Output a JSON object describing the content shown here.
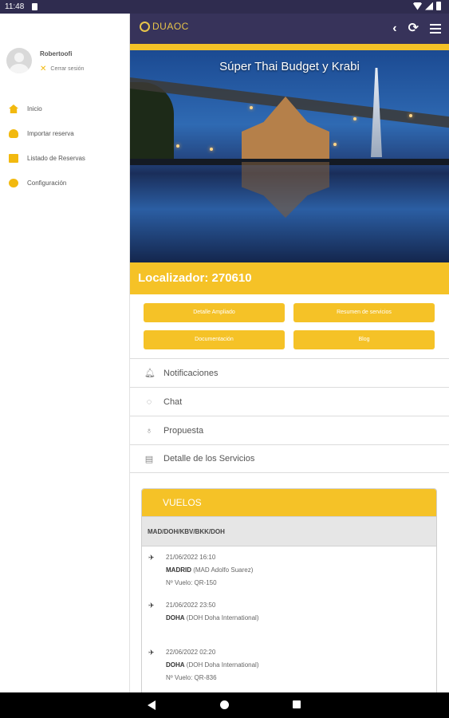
{
  "status_bar": {
    "time": "11:48"
  },
  "drawer": {
    "username": "Robertoofi",
    "logout_label": "Cerrar sesión",
    "items": [
      {
        "label": "Inicio",
        "icon": "home-icon"
      },
      {
        "label": "Importar reserva",
        "icon": "cloud-download-icon"
      },
      {
        "label": "Listado de Reservas",
        "icon": "list-icon"
      },
      {
        "label": "Configuración",
        "icon": "gear-icon"
      }
    ]
  },
  "app_bar": {
    "logo_text": "DUAOC"
  },
  "hero": {
    "title": "Súper Thai Budget y Krabi"
  },
  "locator": "Localizador: 270610",
  "buttons": {
    "detalle": "Detalle Ampliado",
    "resumen": "Resumen de servicios",
    "documentacion": "Documentación",
    "blog": "Blog"
  },
  "menu_list": [
    {
      "label": "Notificaciones",
      "icon": "bell-icon"
    },
    {
      "label": "Chat",
      "icon": "chat-icon"
    },
    {
      "label": "Propuesta",
      "icon": "lightbulb-icon"
    },
    {
      "label": "Detalle de los Servicios",
      "icon": "table-icon"
    }
  ],
  "flights": {
    "header": "VUELOS",
    "route": "MAD/DOH/KBV/BKK/DOH",
    "segments": [
      {
        "icon": "takeoff-icon",
        "datetime": "21/06/2022  16:10",
        "city": "MADRID",
        "airport": " (MAD Adolfo Suarez)",
        "flight": "Nº Vuelo: QR-150"
      },
      {
        "icon": "landing-icon",
        "datetime": "21/06/2022  23:50",
        "city": "DOHA",
        "airport": " (DOH Doha International)",
        "flight": ""
      },
      {
        "icon": "takeoff-icon",
        "datetime": "22/06/2022  02:20",
        "city": "DOHA",
        "airport": " (DOH Doha International)",
        "flight": "Nº Vuelo: QR-836"
      }
    ]
  },
  "colors": {
    "accent": "#f5c227",
    "app_bar": "#37335a",
    "status_bar": "#2f2c4f"
  }
}
